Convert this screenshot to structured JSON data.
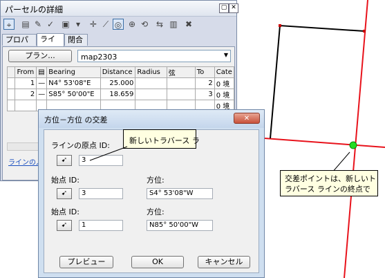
{
  "parcel_window": {
    "title": "パーセルの詳細",
    "controls": {
      "pin": "▢",
      "close": "✕"
    },
    "toolbar_icons": [
      "crosshair-icon",
      "document-icon",
      "edit-icon",
      "check-icon",
      "image-icon",
      "plus-point-icon",
      "line-icon",
      "construct-icon",
      "circle-icon",
      "rotate-icon",
      "link-icon",
      "chart-icon",
      "delete-icon"
    ],
    "tabs": [
      "プロパティ",
      "ライン",
      "閉合"
    ],
    "plan_button": "プラン...",
    "plan_value": "map2303",
    "columns": [
      "From",
      "",
      "Bearing",
      "Distance",
      "Radius",
      "弦",
      "To",
      "Cate"
    ],
    "rows": [
      {
        "from": "1",
        "bearing": "N4° 53'08\"E",
        "distance": "25.000",
        "radius": "",
        "chord": "",
        "to": "2",
        "cate": "0 境"
      },
      {
        "from": "2",
        "bearing": "S85° 50'00\"E",
        "distance": "18.659",
        "radius": "",
        "chord": "",
        "to": "3",
        "cate": "0 境"
      },
      {
        "from": "",
        "bearing": "",
        "distance": "",
        "radius": "",
        "chord": "",
        "to": "",
        "cate": "0 境"
      }
    ],
    "link_text": "ラインの入"
  },
  "dialog": {
    "title": "方位－方位 の交差",
    "close_label": "✕",
    "origin_label": "ラインの原点 ID:",
    "origin_value": "3",
    "start1_label": "始点 ID:",
    "start1_value": "3",
    "dir1_label": "方位:",
    "dir1_value": "S4° 53'08\"W",
    "start2_label": "始点 ID:",
    "start2_value": "1",
    "dir2_label": "方位:",
    "dir2_value": "N85° 50'00\"W",
    "preview_button": "プレビュー",
    "ok_button": "OK",
    "cancel_button": "キャンセル"
  },
  "callouts": {
    "traverse": "新しいトラバース ラ",
    "intersection": "交差ポイントは、新しいトラバース ラインの終点で"
  },
  "colors": {
    "line_red": "#e8121b",
    "point_green": "#22dd22",
    "callout_bg": "#ffffe1"
  }
}
